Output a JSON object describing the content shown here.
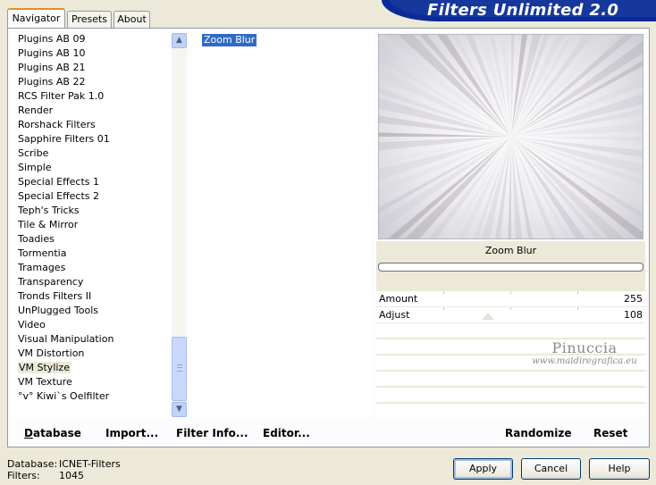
{
  "tabs": [
    {
      "label": "Navigator",
      "active": true
    },
    {
      "label": "Presets",
      "active": false
    },
    {
      "label": "About",
      "active": false
    }
  ],
  "header": {
    "title": "Filters Unlimited 2.0"
  },
  "categories": [
    "Plugins AB 09",
    "Plugins AB 10",
    "Plugins AB 21",
    "Plugins AB 22",
    "RCS Filter Pak 1.0",
    "Render",
    "Rorshack Filters",
    "Sapphire Filters 01",
    "Scribe",
    "Simple",
    "Special Effects 1",
    "Special Effects 2",
    "Teph's Tricks",
    "Tile & Mirror",
    "Toadies",
    "Tormentia",
    "Tramages",
    "Transparency",
    "Tronds Filters II",
    "UnPlugged Tools",
    "Video",
    "Visual Manipulation",
    "VM Distortion",
    "VM Stylize",
    "VM Texture",
    "°v° Kiwi`s Oelfilter"
  ],
  "selected_category": "VM Stylize",
  "filters": [
    "Zoom Blur"
  ],
  "selected_filter": "Zoom Blur",
  "preview": {
    "filter_name": "Zoom Blur"
  },
  "parameters": [
    {
      "name": "Amount",
      "value": "255"
    },
    {
      "name": "Adjust",
      "value": "108"
    }
  ],
  "watermark": {
    "name": "Pinuccia",
    "url": "www.maidiregrafica.eu"
  },
  "toolbar": {
    "database": {
      "mnemonic": "D",
      "rest": "atabase"
    },
    "import": {
      "pre": "Import",
      "mnemonic": "...",
      "label": "Import..."
    },
    "filter_info": "Filter Info...",
    "editor": "Editor...",
    "randomize": "Randomize",
    "reset": "Reset"
  },
  "footer": {
    "database_label": "Database:",
    "database_value": "ICNET-Filters",
    "filters_label": "Filters:",
    "filters_value": "1045"
  },
  "buttons": {
    "apply": "Apply",
    "cancel": "Cancel",
    "help": "Help"
  },
  "colors": {
    "banner": "#16379c",
    "selection": "#316ac5",
    "dialog_bg": "#ece9d8",
    "tab_accent": "#e68b2c"
  }
}
